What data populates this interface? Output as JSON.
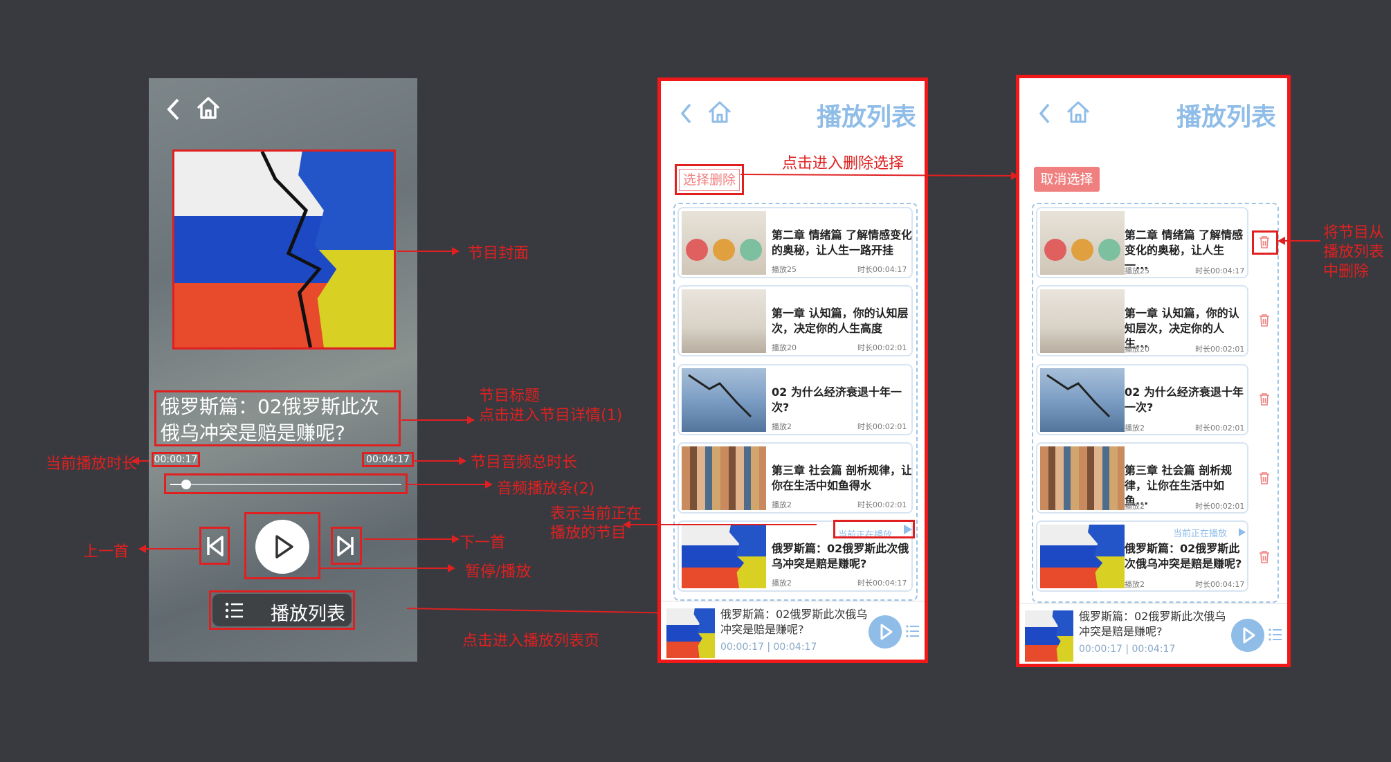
{
  "player": {
    "title": "俄罗斯篇：02俄罗斯此次俄乌冲突是赔是赚呢?",
    "current_time": "00:00:17",
    "total_time": "00:04:17",
    "progress_fraction": 0.07,
    "playlist_button_label": "播放列表"
  },
  "annotations": {
    "cover": "节目封面",
    "title_line1": "节目标题",
    "title_line2": "点击进入节目详情(1)",
    "current_time": "当前播放时长",
    "total_time": "节目音频总时长",
    "progress": "音频播放条(2)",
    "prev": "上一首",
    "next": "下一首",
    "play_pause": "暂停/播放",
    "playlist": "点击进入播放列表页",
    "delete_select": "点击进入删除选择",
    "now_playing_line1": "表示当前正在",
    "now_playing_line2": "播放的节目",
    "remove_line1": "将节目从",
    "remove_line2": "播放列表",
    "remove_line3": "中删除"
  },
  "screen1": {
    "title": "播放列表",
    "select_delete_label": "选择删除",
    "items": [
      {
        "title": "第二章 情绪篇 了解情感变化的奥秘，让人生一路开挂",
        "plays": "播放25",
        "duration": "时长00:04:17"
      },
      {
        "title": "第一章 认知篇，你的认知层次，决定你的人生高度",
        "plays": "播放20",
        "duration": "时长00:02:01"
      },
      {
        "title": "02 为什么经济衰退十年一次?",
        "plays": "播放2",
        "duration": "时长00:02:01"
      },
      {
        "title": "第三章 社会篇 剖析规律，让你在生活中如鱼得水",
        "plays": "播放2",
        "duration": "时长00:02:01"
      },
      {
        "title": "俄罗斯篇：02俄罗斯此次俄乌冲突是赔是赚呢?",
        "plays": "播放2",
        "duration": "时长00:04:17"
      }
    ],
    "now_playing_tag": "当前正在播放",
    "mini_title": "俄罗斯篇：02俄罗斯此次俄乌冲突是赔是赚呢?",
    "mini_time": "00:00:17 | 00:04:17"
  },
  "screen2": {
    "title": "播放列表",
    "cancel_label": "取消选择",
    "items": [
      {
        "title": "第二章 情绪篇 了解情感变化的奥秘，让人生一...",
        "plays": "播放25",
        "duration": "时长00:04:17"
      },
      {
        "title": "第一章 认知篇，你的认知层次，决定你的人生...",
        "plays": "播放20",
        "duration": "时长00:02:01"
      },
      {
        "title": "02 为什么经济衰退十年一次?",
        "plays": "播放2",
        "duration": "时长00:02:01"
      },
      {
        "title": "第三章 社会篇 剖析规律，让你在生活中如鱼...",
        "plays": "播放2",
        "duration": "时长00:02:01"
      },
      {
        "title": "俄罗斯篇：02俄罗斯此次俄乌冲突是赔是赚呢?",
        "plays": "播放2",
        "duration": "时长00:04:17"
      }
    ],
    "now_playing_tag": "当前正在播放",
    "mini_title": "俄罗斯篇：02俄罗斯此次俄乌冲突是赔是赚呢?",
    "mini_time": "00:00:17 | 00:04:17"
  },
  "colors": {
    "accent": "#8fbde8",
    "annotation_red": "#e02020",
    "delete_red": "#f08080",
    "background": "#383a3f"
  }
}
